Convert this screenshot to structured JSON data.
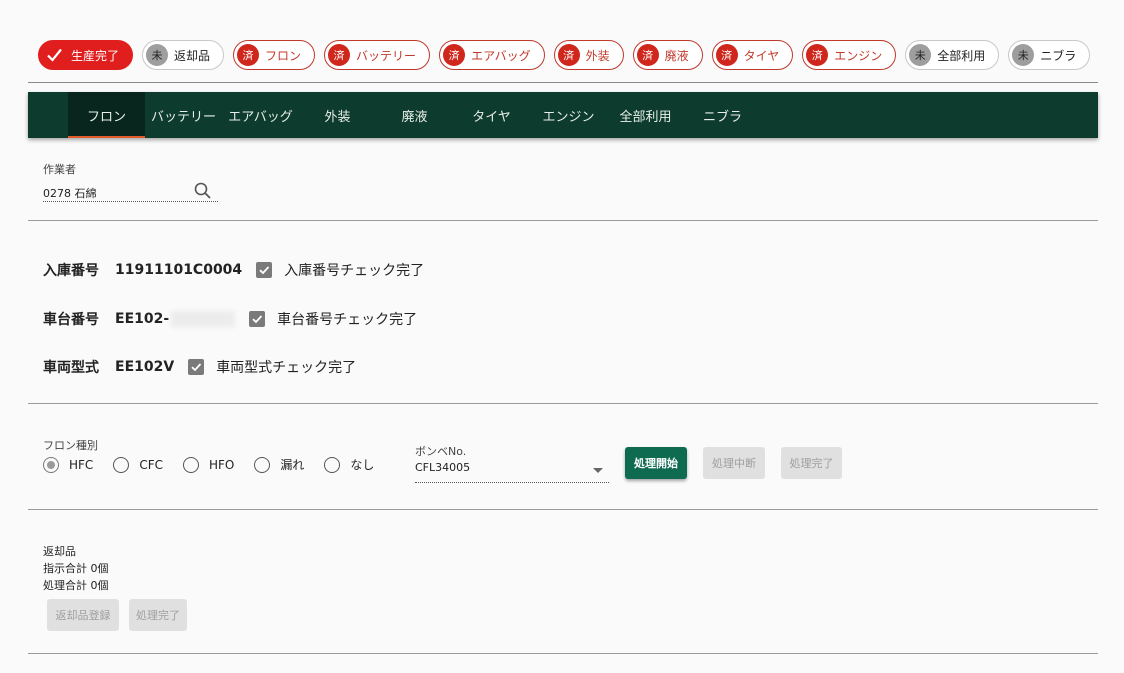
{
  "status_chips": [
    {
      "avatar": "✓",
      "label": "生産完了",
      "style": "primary"
    },
    {
      "avatar": "未",
      "label": "返却品",
      "style": "grey"
    },
    {
      "avatar": "済",
      "label": "フロン",
      "style": "red"
    },
    {
      "avatar": "済",
      "label": "バッテリー",
      "style": "red"
    },
    {
      "avatar": "済",
      "label": "エアバッグ",
      "style": "red"
    },
    {
      "avatar": "済",
      "label": "外装",
      "style": "red"
    },
    {
      "avatar": "済",
      "label": "廃液",
      "style": "red"
    },
    {
      "avatar": "済",
      "label": "タイヤ",
      "style": "red"
    },
    {
      "avatar": "済",
      "label": "エンジン",
      "style": "red"
    },
    {
      "avatar": "未",
      "label": "全部利用",
      "style": "grey"
    },
    {
      "avatar": "未",
      "label": "ニブラ",
      "style": "grey"
    }
  ],
  "tabs": [
    {
      "label": "フロン",
      "active": true
    },
    {
      "label": "バッテリー",
      "active": false
    },
    {
      "label": "エアバッグ",
      "active": false
    },
    {
      "label": "外装",
      "active": false
    },
    {
      "label": "廃液",
      "active": false
    },
    {
      "label": "タイヤ",
      "active": false
    },
    {
      "label": "エンジン",
      "active": false
    },
    {
      "label": "全部利用",
      "active": false
    },
    {
      "label": "ニブラ",
      "active": false
    }
  ],
  "worker": {
    "label": "作業者",
    "value": "0278 石綿"
  },
  "vehicle": {
    "receipt": {
      "label": "入庫番号",
      "value": "11911101C0004",
      "check_label": "入庫番号チェック完了"
    },
    "chassis": {
      "label": "車台番号",
      "value": "EE102-",
      "check_label": "車台番号チェック完了"
    },
    "model": {
      "label": "車両型式",
      "value": "EE102V",
      "check_label": "車両型式チェック完了"
    }
  },
  "freon": {
    "type_label": "フロン種別",
    "options": [
      {
        "label": "HFC",
        "selected": true
      },
      {
        "label": "CFC",
        "selected": false
      },
      {
        "label": "HFO",
        "selected": false
      },
      {
        "label": "漏れ",
        "selected": false
      },
      {
        "label": "なし",
        "selected": false
      }
    ],
    "cylinder_label": "ボンベNo.",
    "cylinder_value": "CFL34005",
    "start_button": "処理開始",
    "pause_button": "処理中断",
    "complete_button": "処理完了"
  },
  "returns": {
    "title": "返却品",
    "instruction_total": "指示合計 0個",
    "processed_total": "処理合計 0個",
    "register_button": "返却品登録",
    "complete_button": "処理完了"
  },
  "colors": {
    "brand_dark": "#0d3b2d",
    "accent_red": "#e01e1e",
    "primary_green": "#0f6b50",
    "tab_indicator": "#e05a2a"
  }
}
